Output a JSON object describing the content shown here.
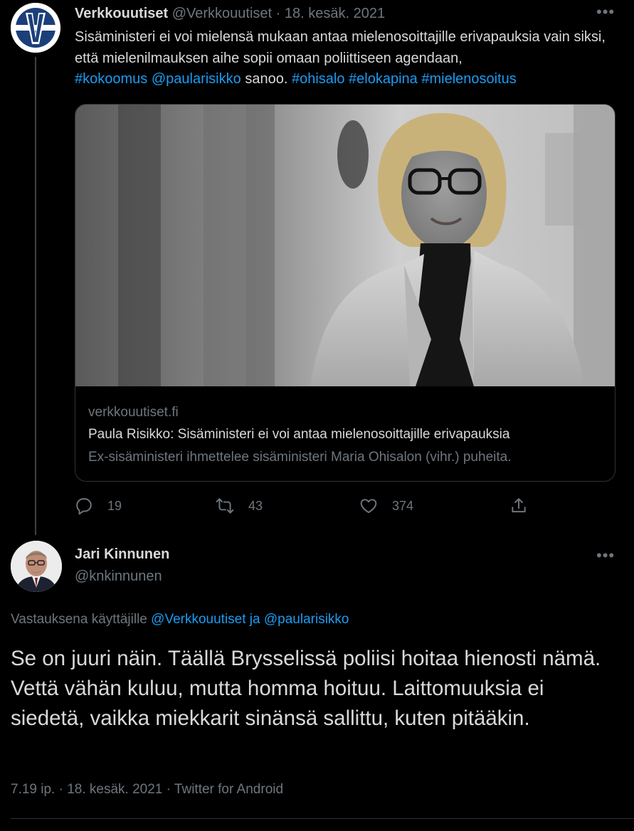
{
  "colors": {
    "background": "#000000",
    "text": "#d9d9d9",
    "muted": "#6e767d",
    "link": "#1d9bf0",
    "border": "#2f3336"
  },
  "tweet": {
    "author_name": "Verkkouutiset",
    "author_handle": "@Verkkouutiset",
    "separator": " · ",
    "date": "18. kesäk. 2021",
    "text_plain": "Sisäministeri ei voi mielensä mukaan antaa mielenosoittajille erivapauksia vain siksi, että mielenilmauksen aihe sopii omaan poliittiseen agendaan,",
    "link_1": "#kokoomus",
    "link_2": "@paularisikko",
    "text_mid": "sanoo.",
    "link_3": "#ohisalo",
    "link_4": "#elokapina",
    "link_5": "#mielenosoitus",
    "card": {
      "domain": "verkkouutiset.fi",
      "title": "Paula Risikko: Sisäministeri ei voi antaa mielenosoittajille erivapauksia",
      "description": "Ex-sisäministeri ihmettelee sisäministeri Maria Ohisalon (vihr.) puheita."
    },
    "actions": {
      "reply_icon": "reply-icon",
      "reply_count": "19",
      "retweet_icon": "retweet-icon",
      "retweet_count": "43",
      "like_icon": "heart-icon",
      "like_count": "374",
      "share_icon": "share-icon"
    },
    "more_icon": "more-icon"
  },
  "reply": {
    "author_name": "Jari Kinnunen",
    "author_handle": "@knkinnunen",
    "replying_prefix": "Vastauksena käyttäjille",
    "replying_user_1": "@Verkkouutiset",
    "replying_and": "ja",
    "replying_user_2": "@paularisikko",
    "text": "Se on juuri näin. Täällä Brysselissä poliisi hoitaa hienosti nämä. Vettä vähän kuluu, mutta homma hoituu. Laittomuuksia ei siedetä, vaikka miekkarit sinänsä sallittu, kuten pitääkin.",
    "time": "7.19 ip.",
    "separator": " · ",
    "date": "18. kesäk. 2021",
    "separator_2": " · ",
    "source": "Twitter for Android",
    "more_icon": "more-icon"
  }
}
